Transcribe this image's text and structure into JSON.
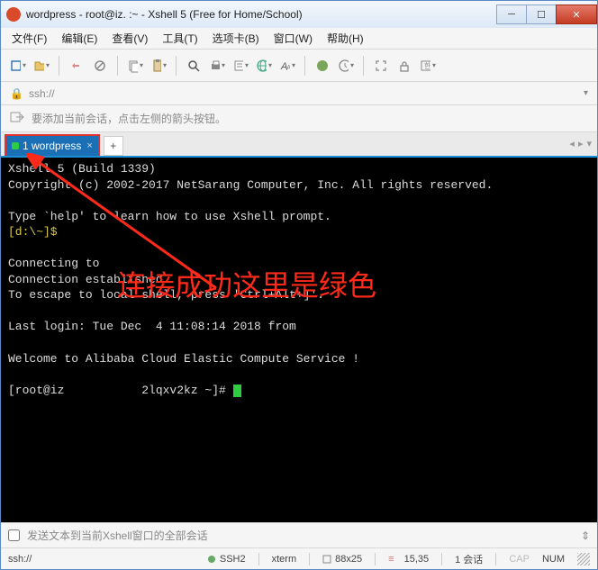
{
  "titlebar": {
    "text": "wordpress - root@iz.                 :~ - Xshell 5 (Free for Home/School)"
  },
  "menu": {
    "file": "文件(F)",
    "edit": "编辑(E)",
    "view": "查看(V)",
    "tools": "工具(T)",
    "tabs": "选项卡(B)",
    "window": "窗口(W)",
    "help": "帮助(H)"
  },
  "addr": {
    "text": "ssh://"
  },
  "hint": {
    "text": "要添加当前会话，点击左侧的箭头按钮。"
  },
  "tab": {
    "label": "1 wordpress"
  },
  "terminal": {
    "l1": "Xshell 5 (Build 1339)",
    "l2": "Copyright (c) 2002-2017 NetSarang Computer, Inc. All rights reserved.",
    "l3": "",
    "l4": "Type `help' to learn how to use Xshell prompt.",
    "l5": "[d:\\~]$",
    "l6": "",
    "l7": "Connecting to",
    "l8": "Connection established.",
    "l9": "To escape to local shell, press 'Ctrl+Alt+]'.",
    "l10": "",
    "l11": "Last login: Tue Dec  4 11:08:14 2018 from",
    "l12": "",
    "l13": "Welcome to Alibaba Cloud Elastic Compute Service !",
    "l14": "",
    "l15": "[root@iz           2lqxv2kz ~]# "
  },
  "sendbar": {
    "placeholder": "发送文本到当前Xshell窗口的全部会话"
  },
  "status": {
    "ssh": "ssh://",
    "proto": "SSH2",
    "term": "xterm",
    "size": "88x25",
    "pos": "15,35",
    "sessions": "1 会话",
    "cap": "CAP",
    "num": "NUM"
  },
  "annotation": {
    "text": "连接成功这里是绿色"
  }
}
